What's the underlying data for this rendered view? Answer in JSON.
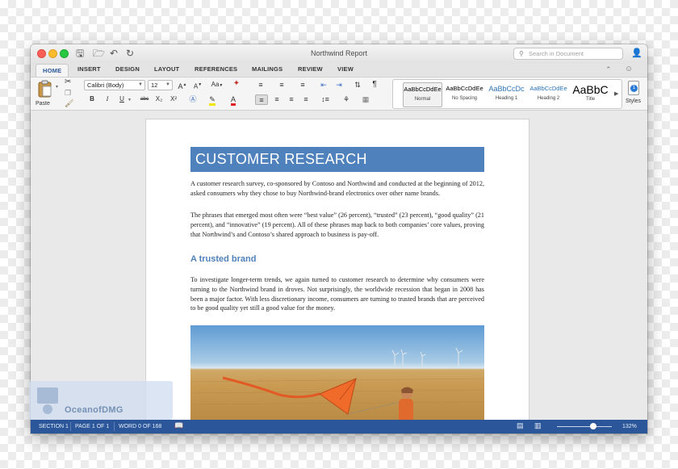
{
  "window": {
    "title": "Northwind Report",
    "search_placeholder": "Search in Document"
  },
  "tabs": [
    "HOME",
    "INSERT",
    "DESIGN",
    "LAYOUT",
    "REFERENCES",
    "MAILINGS",
    "REVIEW",
    "VIEW"
  ],
  "active_tab": "HOME",
  "ribbon": {
    "paste_label": "Paste",
    "font_name": "Calibri (Body)",
    "font_size": "12",
    "bold": "B",
    "italic": "I",
    "underline": "U",
    "strikethrough": "abc",
    "subscript": "X₂",
    "superscript": "X²",
    "grow_font": "A",
    "shrink_font": "A",
    "change_case": "Aa",
    "styles_pane_label": "Styles",
    "styles": [
      {
        "sample": "AaBbCcDdEe",
        "name": "Normal"
      },
      {
        "sample": "AaBbCcDdEe",
        "name": "No Spacing"
      },
      {
        "sample": "AaBbCcDc",
        "name": "Heading 1"
      },
      {
        "sample": "AaBbCcDdEe",
        "name": "Heading 2"
      },
      {
        "sample": "AaBbC",
        "name": "Title"
      }
    ]
  },
  "document": {
    "heading": "CUSTOMER RESEARCH",
    "para1": "A customer research survey, co-sponsored by Contoso and Northwind and conducted at the beginning of 2012, asked consumers why they chose to buy Northwind-brand electronics over other name brands.",
    "para2": "The phrases that emerged most often were “best value” (26 percent), “trusted” (23 percent), “good quality” (21 percent), and “innovative” (19 percent). All of these phrases map back to both companies’ core values, proving that Northwind’s and Contoso’s shared approach to business is pay-off.",
    "subheading": "A trusted brand",
    "para3": "To investigate longer-term trends, we again turned to customer research to determine why consumers were turning to the Northwind brand in droves. Not surprisingly, the worldwide recession that began in 2008 has been a major factor. With less discretionary income, consumers are turning to trusted brands that are perceived to be good quality yet still a good value for the money."
  },
  "statusbar": {
    "section": "SECTION 1",
    "page": "PAGE 1 OF 1",
    "words": "WORD 0 OF 168",
    "zoom": "132%"
  },
  "watermark": "OceanofDMG",
  "colors": {
    "accent": "#2b579a",
    "heading_fill": "#4f81bd"
  }
}
